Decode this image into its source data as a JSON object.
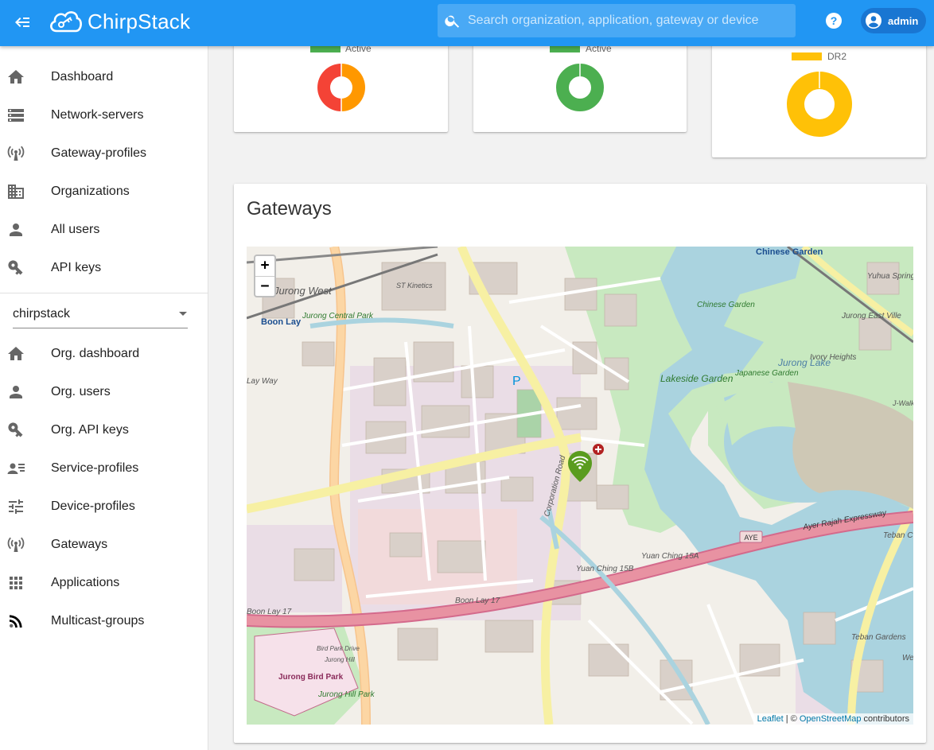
{
  "app": {
    "brand": "ChirpStack"
  },
  "header": {
    "search_placeholder": "Search organization, application, gateway or device",
    "user": "admin"
  },
  "sidebar": {
    "global_items": [
      {
        "label": "Dashboard",
        "icon": "home-icon"
      },
      {
        "label": "Network-servers",
        "icon": "server-icon"
      },
      {
        "label": "Gateway-profiles",
        "icon": "radio-tower-icon"
      },
      {
        "label": "Organizations",
        "icon": "domain-icon"
      },
      {
        "label": "All users",
        "icon": "account-icon"
      },
      {
        "label": "API keys",
        "icon": "key-icon"
      }
    ],
    "organization_select": "chirpstack",
    "org_items": [
      {
        "label": "Org. dashboard",
        "icon": "home-icon"
      },
      {
        "label": "Org. users",
        "icon": "account-icon"
      },
      {
        "label": "Org. API keys",
        "icon": "key-icon"
      },
      {
        "label": "Service-profiles",
        "icon": "account-details-icon"
      },
      {
        "label": "Device-profiles",
        "icon": "tune-icon"
      },
      {
        "label": "Gateways",
        "icon": "radio-tower-icon"
      },
      {
        "label": "Applications",
        "icon": "apps-icon"
      },
      {
        "label": "Multicast-groups",
        "icon": "rss-icon"
      }
    ]
  },
  "cards": {
    "active_devices": {
      "legend": "Active",
      "colors": [
        "#f44336",
        "#ff9800"
      ],
      "values": [
        50,
        50
      ]
    },
    "active_gateways": {
      "legend": "Active",
      "colors": [
        "#4caf50"
      ],
      "values": [
        100
      ]
    },
    "data_rate": {
      "legend": "DR2",
      "colors": [
        "#ffc107"
      ],
      "values": [
        100
      ]
    }
  },
  "gateways_card": {
    "title": "Gateways",
    "map": {
      "zoom_in": "+",
      "zoom_out": "−",
      "attribution": {
        "leaflet": "Leaflet",
        "sep": " | © ",
        "osm": "OpenStreetMap",
        "suffix": " contributors"
      },
      "labels": {
        "jurong_west": "Jurong West",
        "boon_lay": "Boon Lay",
        "jurong_central_park": "Jurong Central Park",
        "st_kinetics": "ST Kinetics",
        "chinese_garden_top": "Chinese Garden",
        "chinese_garden": "Chinese Garden",
        "yuhua_spring": "Yuhua Spring",
        "jurong_east_ville": "Jurong East Ville",
        "ivory_heights": "Ivory Heights",
        "jurong_lake": "Jurong Lake",
        "japanese_garden": "Japanese Garden",
        "lakeside_garden": "Lakeside Garden",
        "j_walk": "J-Walk",
        "corporation_road": "Corporation Road",
        "ayer_rajah_expressway": "Ayer Rajah Expressway",
        "aye": "AYE",
        "teban_c": "Teban C",
        "yuan_ching_15a": "Yuan Ching 15A",
        "yuan_ching_15b": "Yuan Ching 15B",
        "boon_lay_17": "Boon Lay 17",
        "boon_lay_17_left": "Boon Lay 17",
        "lay_way": "Lay Way",
        "bird_park_drive": "Bird Park Drive",
        "jurong_hill": "Jurong Hill",
        "jurong_bird_park": "Jurong Bird Park",
        "jurong_hill_park": "Jurong Hill Park",
        "teban_gardens": "Teban Gardens",
        "we": "We",
        "parking": "P"
      }
    }
  }
}
